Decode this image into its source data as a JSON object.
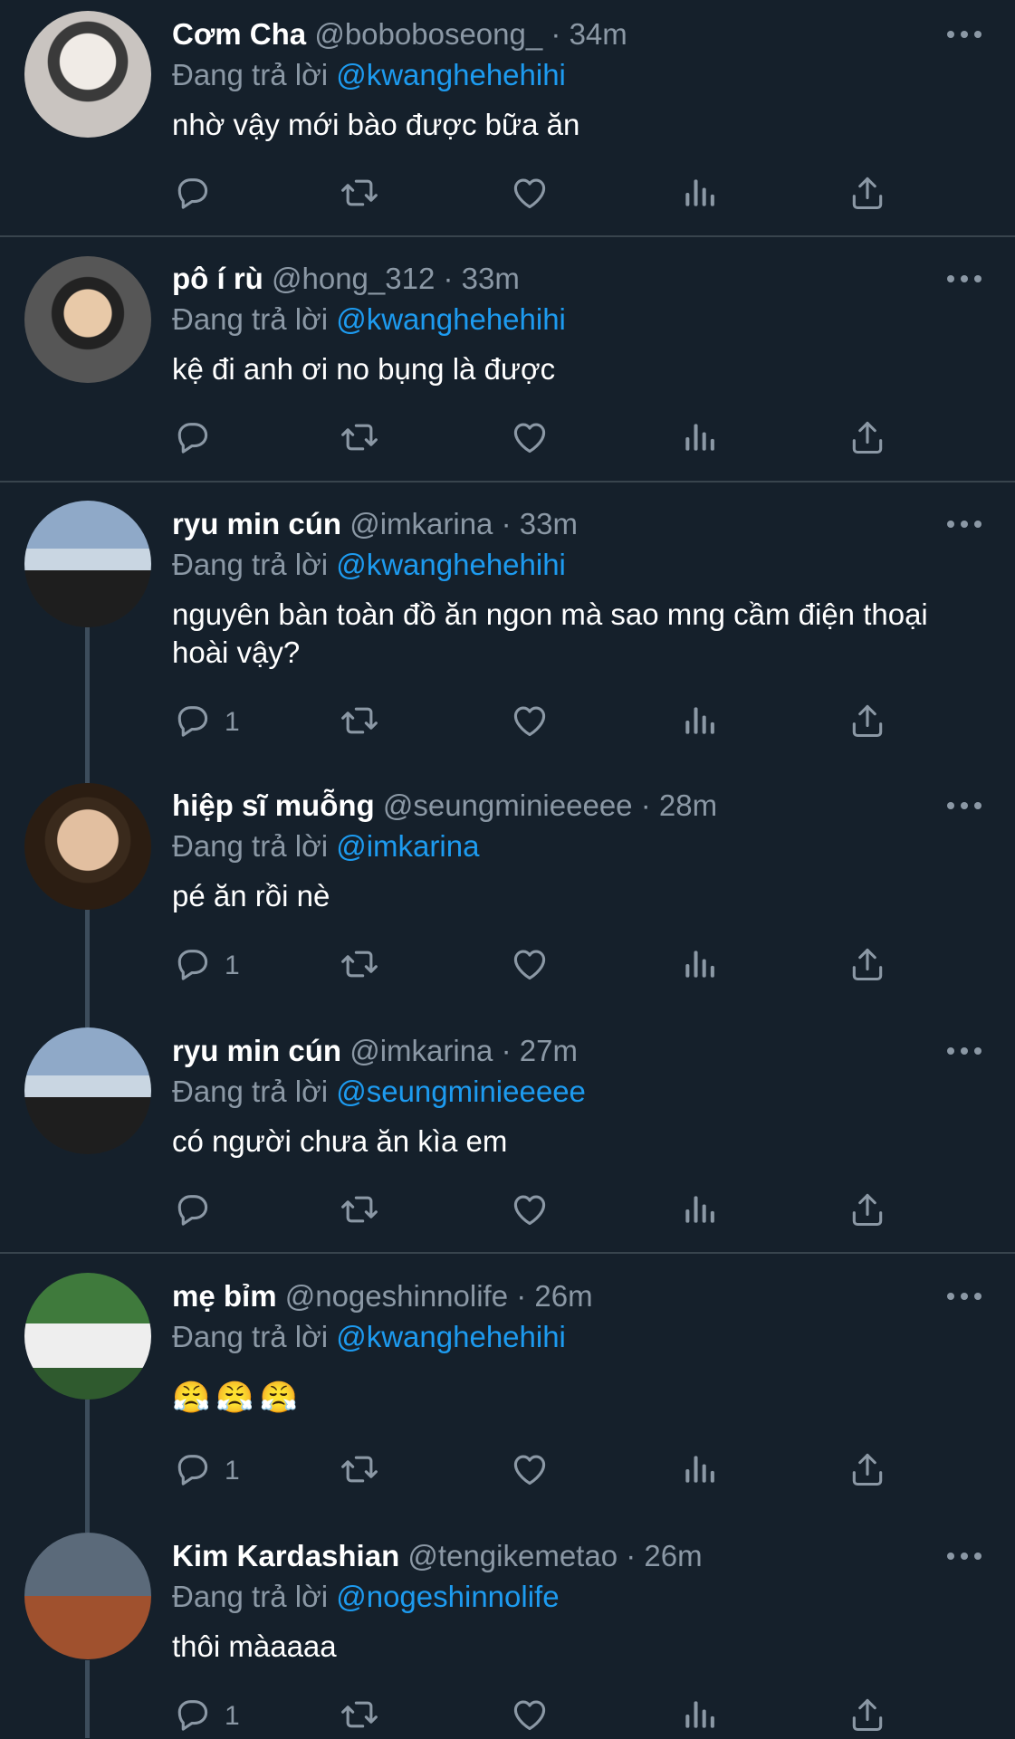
{
  "reply_prefix": "Đang trả lời",
  "tweets": [
    {
      "name": "Cơm Cha",
      "handle": "@boboboseong_",
      "dot": "·",
      "time": "34m",
      "reply_to": "@kwanghehehihi",
      "text": "nhờ vậy mới bào được bữa ăn",
      "reply_count": ""
    },
    {
      "name": "pô í rù",
      "handle": "@hong_312",
      "dot": "·",
      "time": "33m",
      "reply_to": "@kwanghehehihi",
      "text": "kệ đi anh ơi no bụng là được",
      "reply_count": ""
    },
    {
      "name": "ryu min cún",
      "handle": "@imkarina",
      "dot": "·",
      "time": "33m",
      "reply_to": "@kwanghehehihi",
      "text": "nguyên bàn toàn đồ ăn ngon mà sao mng cầm điện thoại hoài vậy?",
      "reply_count": "1"
    },
    {
      "name": "hiệp sĩ muỗng",
      "handle": "@seungminieeeee",
      "dot": "·",
      "time": "28m",
      "reply_to": "@imkarina",
      "text": "pé ăn rồi nè",
      "reply_count": "1"
    },
    {
      "name": "ryu min cún",
      "handle": "@imkarina",
      "dot": "·",
      "time": "27m",
      "reply_to": "@seungminieeeee",
      "text": "có người chưa ăn kìa em",
      "reply_count": ""
    },
    {
      "name": "mẹ bỉm",
      "handle": "@nogeshinnolife",
      "dot": "·",
      "time": "26m",
      "reply_to": "@kwanghehehihi",
      "text": "😤😤😤",
      "reply_count": "1"
    },
    {
      "name": "Kim Kardashian",
      "handle": "@tengikemetao",
      "dot": "·",
      "time": "26m",
      "reply_to": "@nogeshinnolife",
      "text": "thôi màaaaa",
      "reply_count": "1"
    }
  ],
  "icons": {
    "reply": "reply-icon",
    "retweet": "retweet-icon",
    "like": "heart-icon",
    "views": "analytics-icon",
    "share": "share-icon",
    "more": "more-icon"
  },
  "colors": {
    "background": "#15202b",
    "secondary_text": "#8b98a5",
    "mention": "#1d9bf0",
    "divider": "#38444d"
  }
}
